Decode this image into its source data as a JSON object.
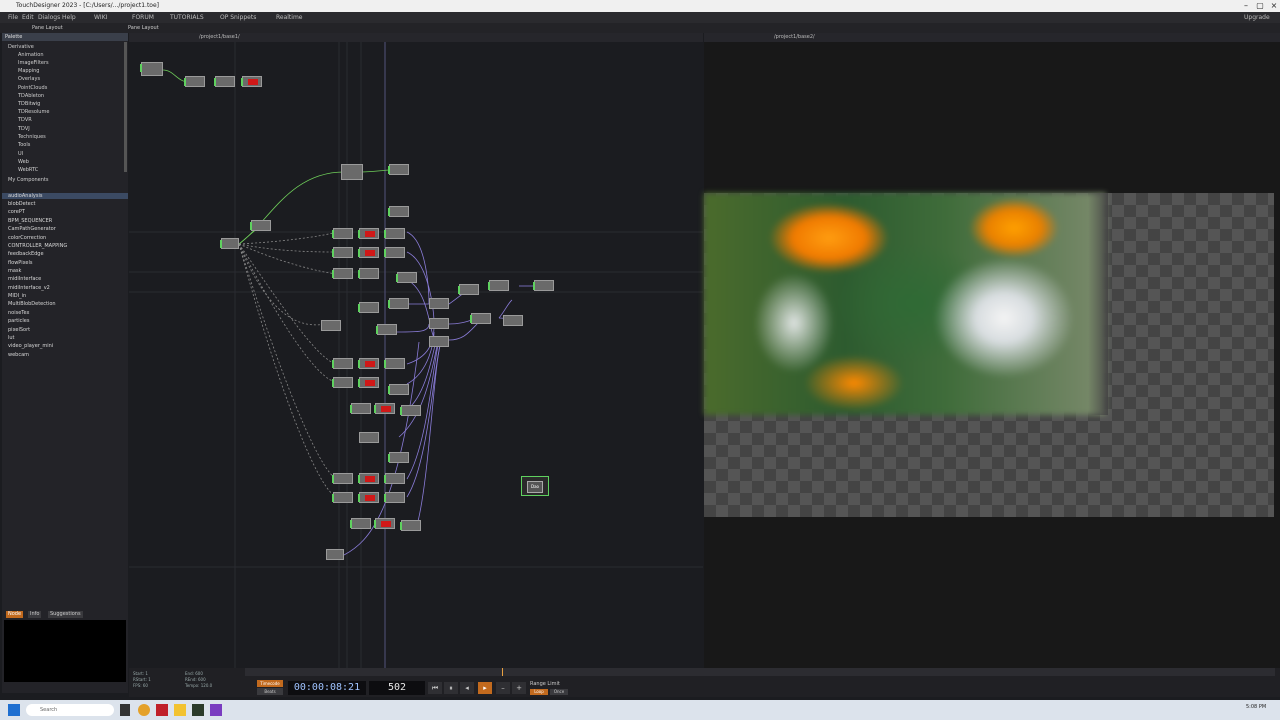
{
  "window": {
    "title": "TouchDesigner 2023 - [C:/Users/.../project1.toe]"
  },
  "menu": [
    "File",
    "Edit",
    "Dialogs",
    "Help",
    "WIKI",
    "FORUM",
    "TUTORIALS",
    "OP Snippets",
    "Realtime"
  ],
  "menu_right": "Upgrade",
  "toolbar": {
    "pane_label": "Pane Layout"
  },
  "palette": {
    "header": "Palette",
    "tree": [
      "Derivative",
      "Animation",
      "ImageFilters",
      "Mapping",
      "Overlays",
      "PointClouds",
      "TDAbleton",
      "TDBitwig",
      "TDResolume",
      "TDVR",
      "TDVJ",
      "Techniques",
      "Tools",
      "UI",
      "Web",
      "WebRTC",
      "My Components"
    ],
    "components": [
      "audioAnalysis",
      "blobDetect",
      "corePT",
      "BPM_SEQUENCER",
      "CamPathGenerator",
      "colorCorrection",
      "CONTROLLER_MAPPING",
      "feedbackEdge",
      "flowPixels",
      "mask",
      "midiInterface",
      "midiInterface_v2",
      "MIDI_in",
      "MultiBlobDetection",
      "noiseTex",
      "particles",
      "pixelSort",
      "lut",
      "video_player_mini",
      "webcam"
    ]
  },
  "info": {
    "tabs": [
      "Node",
      "Info",
      "Suggestions"
    ]
  },
  "network": {
    "path": "/project1/base1/",
    "viewer_path": "/project1/base2/"
  },
  "timeline": {
    "timecode": "00:00:08:21",
    "frame": "502",
    "range_label": "Range Limit",
    "loop_label": "Loop",
    "once_label": "Once",
    "timecode_label": "Timecode",
    "beats_label": "Beats",
    "stats": [
      {
        "k": "Start",
        "v": "1"
      },
      {
        "k": "End",
        "v": "600"
      },
      {
        "k": "RStart",
        "v": "1"
      },
      {
        "k": "REnd",
        "v": "600"
      },
      {
        "k": "FPS",
        "v": "60"
      },
      {
        "k": "Tempo",
        "v": "120.0"
      }
    ]
  },
  "taskbar": {
    "search_placeholder": "Search",
    "clock": "5:08 PM"
  },
  "dao_node": "Dao"
}
